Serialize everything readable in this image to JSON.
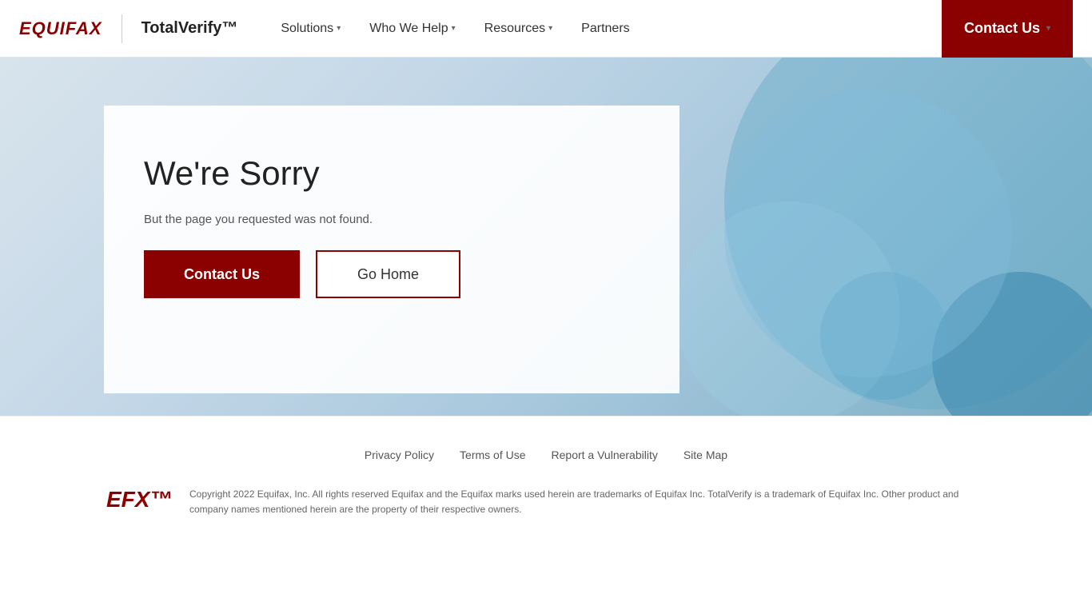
{
  "header": {
    "equifax_label": "EQUIFAX",
    "totalverify_label": "TotalVerify™",
    "nav": [
      {
        "label": "Solutions",
        "has_dropdown": true
      },
      {
        "label": "Who We Help",
        "has_dropdown": true
      },
      {
        "label": "Resources",
        "has_dropdown": true
      },
      {
        "label": "Partners",
        "has_dropdown": false
      }
    ],
    "contact_us_label": "Contact Us"
  },
  "hero": {
    "error_title": "We're Sorry",
    "error_subtitle": "But the page you requested was not found.",
    "contact_us_btn": "Contact Us",
    "go_home_btn": "Go Home"
  },
  "footer": {
    "links": [
      {
        "label": "Privacy Policy"
      },
      {
        "label": "Terms of Use"
      },
      {
        "label": "Report a Vulnerability"
      },
      {
        "label": "Site Map"
      }
    ],
    "efx_label": "EFX™",
    "copyright": "Copyright 2022 Equifax, Inc. All rights reserved Equifax and the Equifax marks used herein are trademarks of Equifax Inc. TotalVerify is a trademark of Equifax Inc. Other product and company names mentioned herein are the property of their respective owners."
  }
}
